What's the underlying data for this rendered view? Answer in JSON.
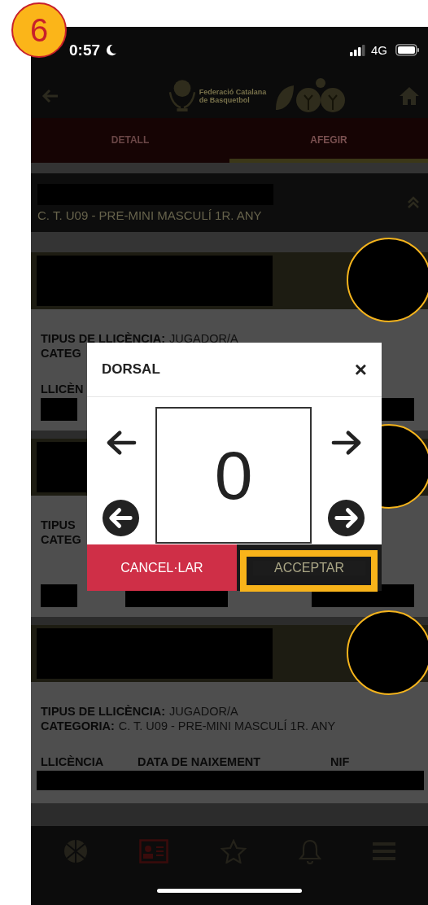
{
  "annotation": {
    "number": "6"
  },
  "status_bar": {
    "time": "0:57",
    "network": "4G"
  },
  "header": {
    "logo_lines": [
      "Federació Catalana",
      "de Basquetbol"
    ]
  },
  "tabs": [
    {
      "label": "DETALL",
      "selected": false
    },
    {
      "label": "AFEGIR",
      "selected": true
    }
  ],
  "team": {
    "category": "C. T. U09 - PRE-MINI MASCULÍ 1R. ANY",
    "expanded": true
  },
  "players": [
    {
      "lines": [
        {
          "label": "TIPUS DE LLICÈNCIA:",
          "value": "JUGADOR/A"
        },
        {
          "label": "CATEG"
        }
      ],
      "columns": [
        "LLICÈN"
      ],
      "kind": "edges"
    },
    {
      "lines": [
        {
          "label": "TIPUS"
        },
        {
          "label": "CATEG"
        }
      ],
      "kind": "split"
    },
    {
      "lines": [
        {
          "label": "TIPUS DE LLICÈNCIA:",
          "value": "JUGADOR/A"
        },
        {
          "label": "CATEGORIA:",
          "value": "C. T. U09 - PRE-MINI MASCULÍ 1R. ANY"
        }
      ],
      "columns": [
        "LLICÈNCIA",
        "DATA DE NAIXEMENT",
        "NIF"
      ],
      "kind": "full"
    }
  ],
  "dialog": {
    "title": "DORSAL",
    "close": "×",
    "number": "0",
    "cancel": "CANCEL·LAR",
    "accept": "ACCEPTAR",
    "accept_highlighted": true
  },
  "bottom_nav": [
    {
      "kind": "basketball",
      "selected": false
    },
    {
      "kind": "card",
      "selected": true
    },
    {
      "kind": "star",
      "selected": false
    },
    {
      "kind": "bell",
      "selected": false
    },
    {
      "kind": "menu",
      "selected": false
    }
  ]
}
